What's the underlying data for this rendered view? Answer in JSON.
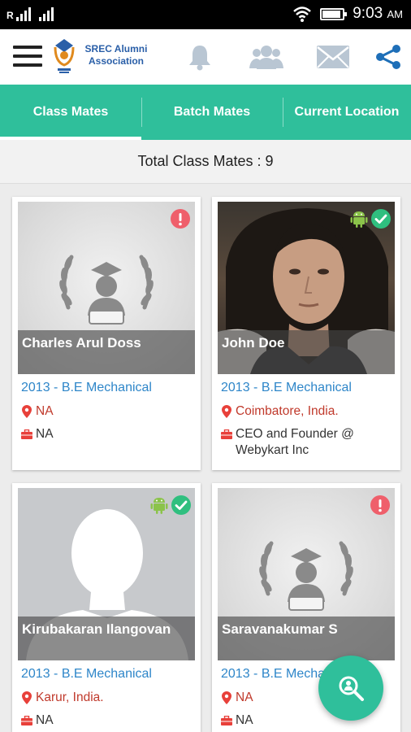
{
  "status_bar": {
    "time": "9:03",
    "ampm": "AM"
  },
  "app": {
    "brand_line1": "SREC Alumni",
    "brand_line2": "Association"
  },
  "tabs": [
    {
      "label": "Class Mates",
      "active": true
    },
    {
      "label": "Batch Mates",
      "active": false
    },
    {
      "label": "Current Location",
      "active": false
    }
  ],
  "total_label": "Total Class Mates : 9",
  "colors": {
    "accent": "#2fbf9b",
    "link_blue": "#2e86c9",
    "location_red": "#c0392b",
    "verified_green": "#2fbf7f",
    "alert_red": "#ef5f6b",
    "android_green": "#8bc34a"
  },
  "cards": [
    {
      "name": "Charles Arul Doss",
      "batch": "2013 - B.E Mechanical",
      "location": "NA",
      "work": "NA",
      "photo": "graduate-placeholder",
      "status": "alert"
    },
    {
      "name": "John Doe",
      "batch": "2013 - B.E Mechanical",
      "location": "Coimbatore, India.",
      "work": "CEO and Founder @ Webykart Inc",
      "photo": "profile-photo",
      "status": "verified",
      "android": true
    },
    {
      "name": "Kirubakaran Ilangovan",
      "batch": "2013 - B.E Mechanical",
      "location": "Karur, India.",
      "work": "NA",
      "photo": "silhouette-placeholder",
      "status": "verified",
      "android": true
    },
    {
      "name": "Saravanakumar S",
      "batch": "2013 - B.E Mechanical",
      "location": "NA",
      "work": "NA",
      "photo": "graduate-placeholder",
      "status": "alert"
    }
  ],
  "icons": [
    "menu-icon",
    "bell-icon",
    "group-icon",
    "mail-icon",
    "share-icon",
    "location-pin-icon",
    "briefcase-icon",
    "alert-icon",
    "check-icon",
    "android-icon",
    "search-person-icon"
  ]
}
